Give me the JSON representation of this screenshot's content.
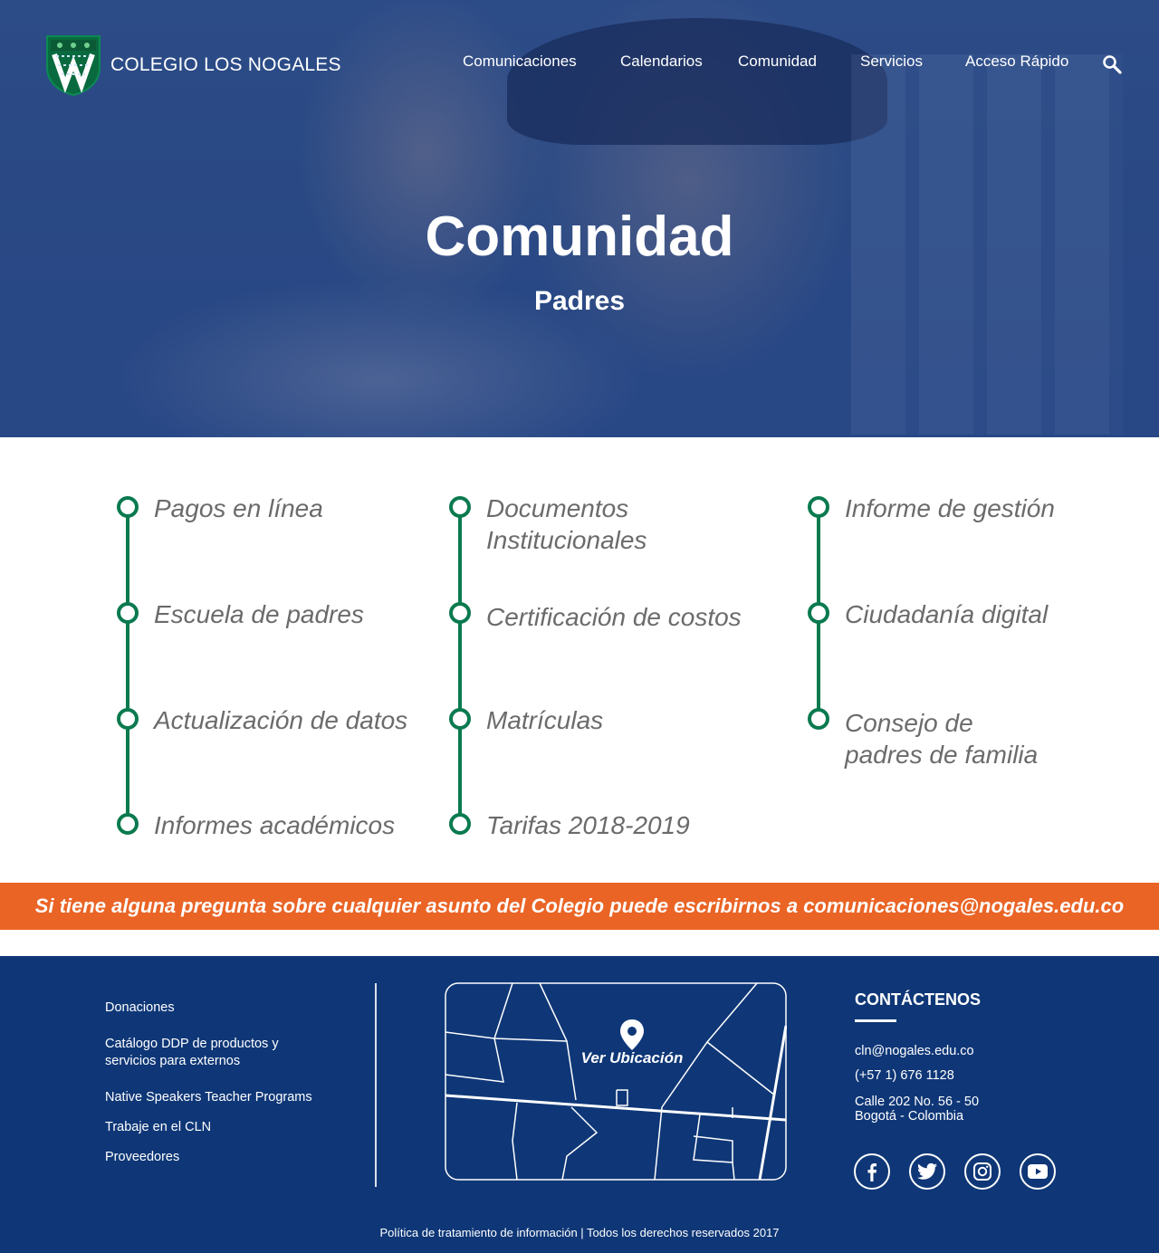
{
  "brand": {
    "name": "COLEGIO LOS NOGALES"
  },
  "nav": {
    "items": [
      "Comunicaciones",
      "Calendarios",
      "Comunidad",
      "Servicios",
      "Acceso Rápido"
    ],
    "search_icon": "search-icon"
  },
  "hero": {
    "title": "Comunidad",
    "subtitle": "Padres"
  },
  "links": {
    "columns": [
      [
        "Pagos en línea",
        "Escuela de padres",
        "Actualización de datos",
        "Informes académicos"
      ],
      [
        "Documentos Institucionales",
        "Certificación de costos",
        "Matrículas",
        "Tarifas 2018-2019"
      ],
      [
        "Informe de gestión",
        "Ciudadanía digital",
        "Consejo de padres de familia"
      ]
    ]
  },
  "banner": {
    "text": "Si tiene alguna pregunta sobre cualquier asunto del Colegio puede escribirnos a comunicaciones@nogales.edu.co"
  },
  "footer": {
    "links": [
      "Donaciones",
      "Catálogo DDP de productos y servicios para externos",
      "Native Speakers Teacher Programs",
      "Trabaje en el CLN",
      "Proveedores"
    ],
    "map_label": "Ver Ubicación",
    "contact": {
      "title": "CONTÁCTENOS",
      "email": "cln@nogales.edu.co",
      "phone": "(+57 1) 676 1128",
      "address_line1": "Calle 202 No. 56 - 50",
      "address_line2": "Bogotá - Colombia"
    },
    "social": [
      "facebook-icon",
      "twitter-icon",
      "instagram-icon",
      "youtube-icon"
    ],
    "legal": "Política de tratamiento de información | Todos los derechos reservados 2017"
  },
  "colors": {
    "accent_green": "#0a7a4f",
    "banner_orange": "#ea6425",
    "footer_navy": "#0f3777"
  }
}
